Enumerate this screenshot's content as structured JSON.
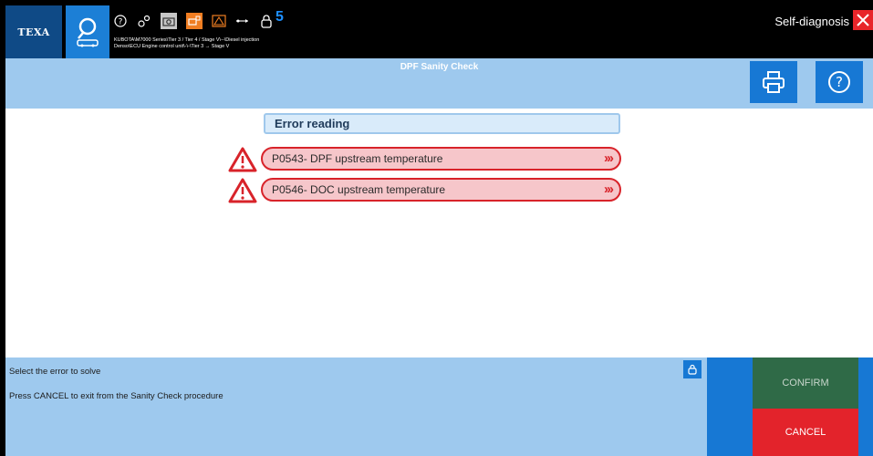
{
  "topbar": {
    "brand": "TEXA",
    "counter": "5",
    "path_line1": "KUBOTA\\M7000 Series\\Tier 3 / Tier 4 / Stage V\\--\\Diesel injection",
    "path_line2": "Denso\\ECU Engine control unit\\-\\-\\Tier 3 → Stage V",
    "section": "Self-diagnosis",
    "icons": [
      "help-icon",
      "gears-icon",
      "camera-icon",
      "vehicle-icon",
      "warning-icon",
      "usb-icon",
      "lock-icon"
    ]
  },
  "header": {
    "title": "DPF Sanity Check"
  },
  "content": {
    "panel_title": "Error reading",
    "errors": [
      {
        "label": "P0543- DPF upstream temperature"
      },
      {
        "label": "P0546- DOC upstream temperature"
      }
    ],
    "chevron": "›››"
  },
  "footer": {
    "msg1": "Select the error to solve",
    "msg2": "Press CANCEL to exit from the Sanity Check procedure",
    "confirm": "CONFIRM",
    "cancel": "CANCEL"
  },
  "colors": {
    "accent_blue": "#1778d4",
    "light_blue": "#9ec9ee",
    "error_red": "#d8232a",
    "confirm_green": "#2f6a47"
  }
}
